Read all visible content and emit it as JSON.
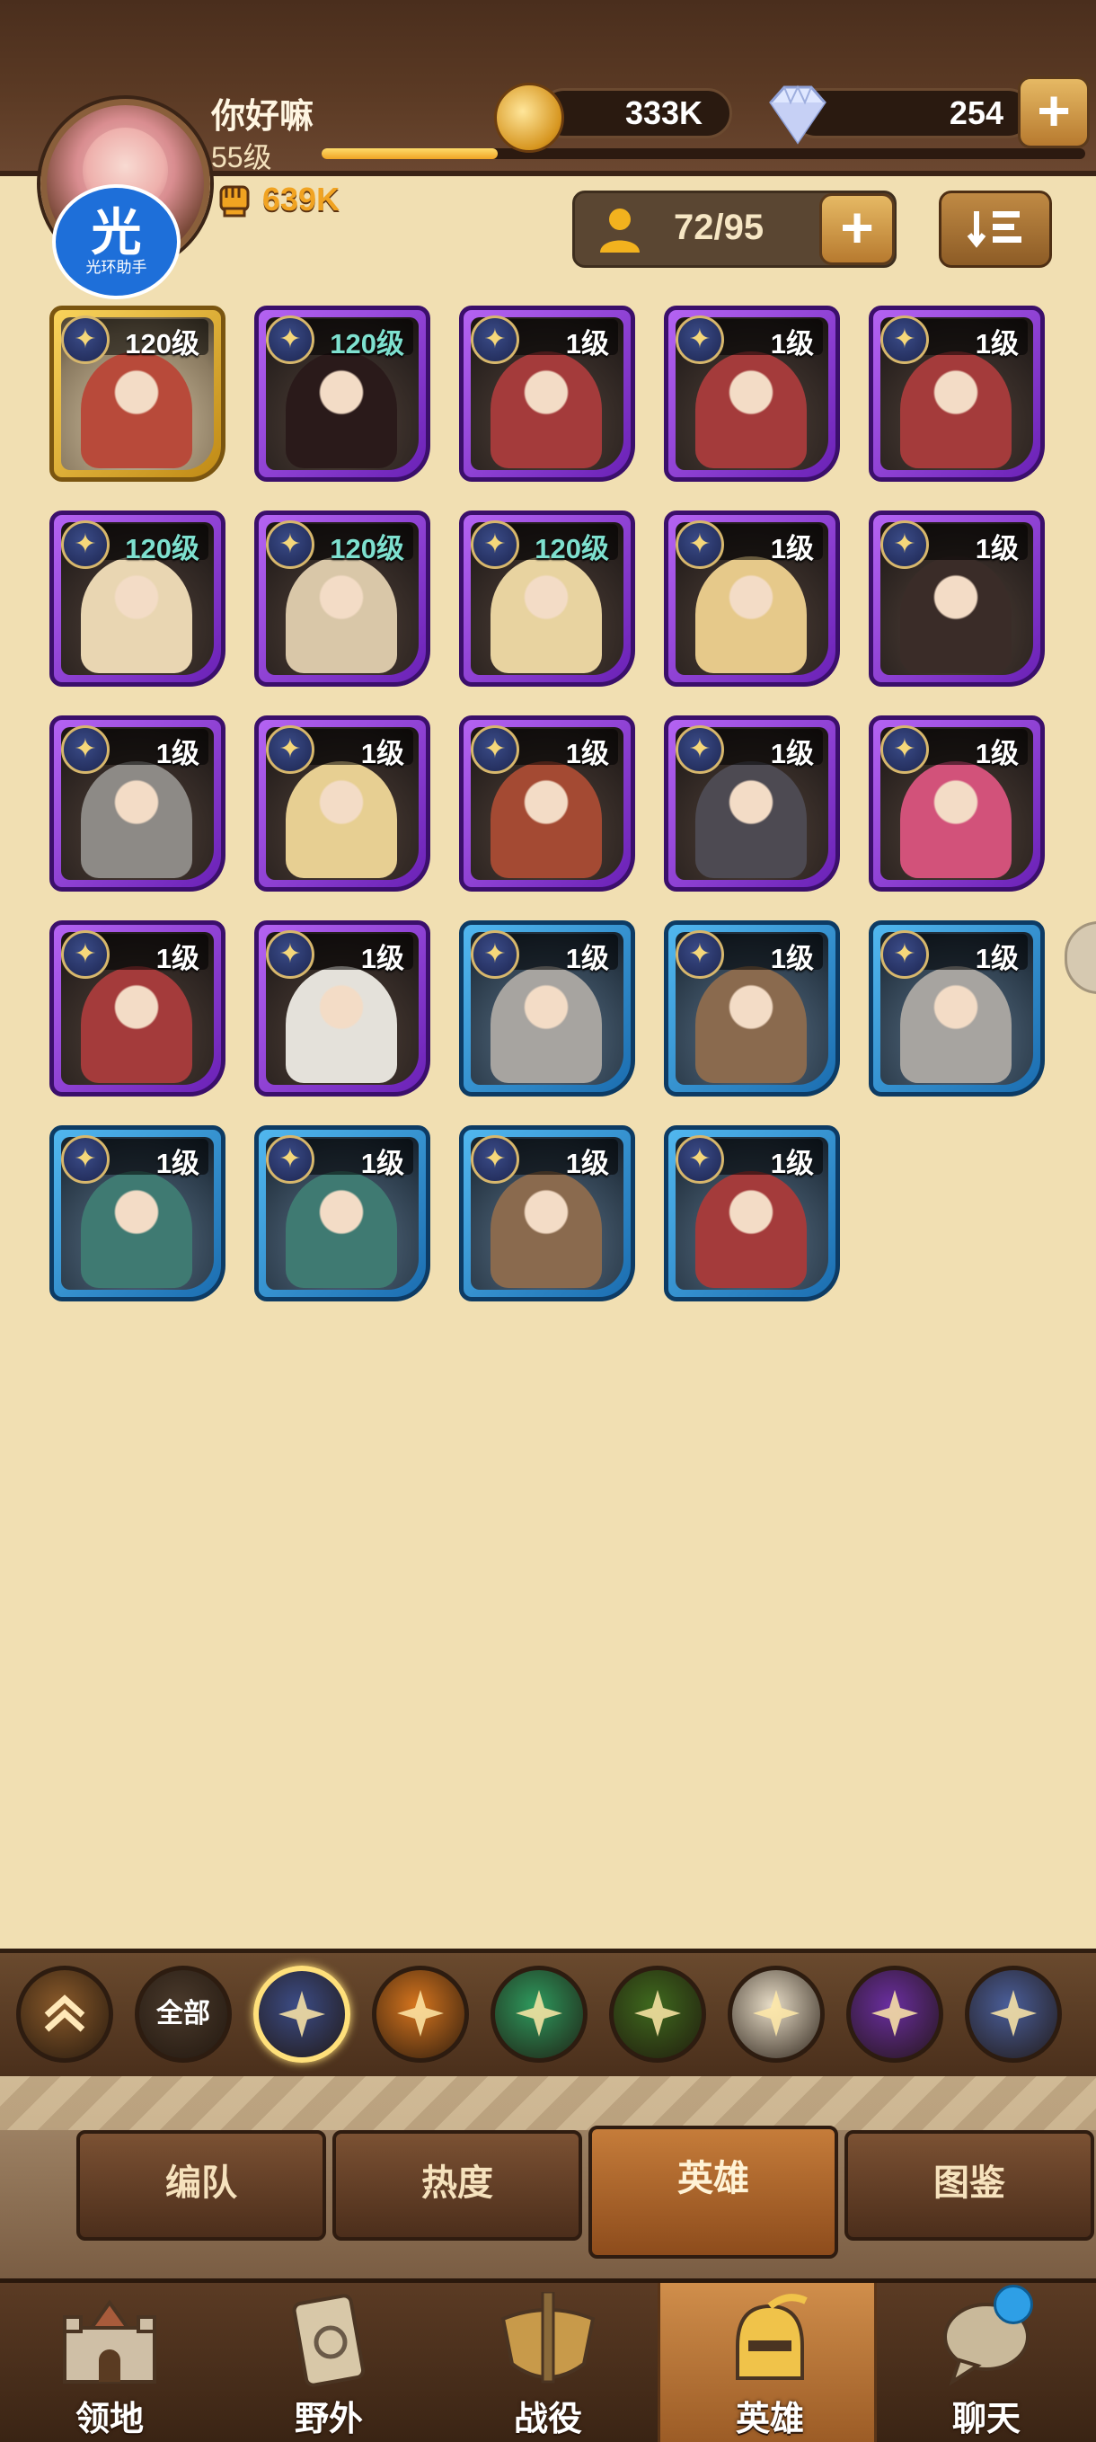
{
  "player": {
    "name": "你好嘛",
    "level": "55级",
    "power": "639K",
    "xp_fraction": 0.23
  },
  "resources": {
    "gold": "333K",
    "diamonds": "254"
  },
  "assistant_badge": {
    "glyph": "光",
    "label": "光环助手"
  },
  "hero_count": "72/95",
  "sort_icon": "sort-list-icon",
  "heroes": [
    {
      "level": "120级",
      "frame": "gold",
      "portrait": "#b84a3a"
    },
    {
      "level": "120级",
      "frame": "purple",
      "portrait": "#2a1a1a"
    },
    {
      "level": "1级",
      "frame": "purple",
      "portrait": "#a43b3b"
    },
    {
      "level": "1级",
      "frame": "purple",
      "portrait": "#a43b3b"
    },
    {
      "level": "1级",
      "frame": "purple",
      "portrait": "#a43b3b"
    },
    {
      "level": "120级",
      "frame": "purple",
      "portrait": "#e9d6b2"
    },
    {
      "level": "120级",
      "frame": "purple",
      "portrait": "#d9c7a8"
    },
    {
      "level": "120级",
      "frame": "purple",
      "portrait": "#e8d3a0"
    },
    {
      "level": "1级",
      "frame": "purple",
      "portrait": "#e6c98a"
    },
    {
      "level": "1级",
      "frame": "purple",
      "portrait": "#3a2c28"
    },
    {
      "level": "1级",
      "frame": "purple",
      "portrait": "#8d8a86"
    },
    {
      "level": "1级",
      "frame": "purple",
      "portrait": "#e7cf92"
    },
    {
      "level": "1级",
      "frame": "purple",
      "portrait": "#a44a33"
    },
    {
      "level": "1级",
      "frame": "purple",
      "portrait": "#4d4a52"
    },
    {
      "level": "1级",
      "frame": "purple",
      "portrait": "#d2527a"
    },
    {
      "level": "1级",
      "frame": "purple",
      "portrait": "#a43b3b"
    },
    {
      "level": "1级",
      "frame": "purple",
      "portrait": "#e4e1da"
    },
    {
      "level": "1级",
      "frame": "blue",
      "portrait": "#a7a4a0"
    },
    {
      "level": "1级",
      "frame": "blue",
      "portrait": "#8a6a4e"
    },
    {
      "level": "1级",
      "frame": "blue",
      "portrait": "#a7a4a0"
    },
    {
      "level": "1级",
      "frame": "blue",
      "portrait": "#3f7a72"
    },
    {
      "level": "1级",
      "frame": "blue",
      "portrait": "#3f7a72"
    },
    {
      "level": "1级",
      "frame": "blue",
      "portrait": "#8a6a4e"
    },
    {
      "level": "1级",
      "frame": "blue",
      "portrait": "#a43b3b"
    }
  ],
  "filters": [
    {
      "icon": "collapse-chevron-icon",
      "label": "",
      "color": "#8a5a2a"
    },
    {
      "icon": "all-factions-icon",
      "label": "全部",
      "color": "#4a3a2c"
    },
    {
      "icon": "lightbearer-star-icon",
      "label": "",
      "color": "#3c4c86",
      "active": true
    },
    {
      "icon": "mauler-icon",
      "label": "",
      "color": "#d6751e"
    },
    {
      "icon": "wilder-leaf-icon",
      "label": "",
      "color": "#2e9a5e"
    },
    {
      "icon": "graveborn-eye-icon",
      "label": "",
      "color": "#3f6a1e"
    },
    {
      "icon": "celestial-icon",
      "label": "",
      "color": "#e8ddc7"
    },
    {
      "icon": "hypogean-icon",
      "label": "",
      "color": "#6a2ea0"
    },
    {
      "icon": "dimensional-icon",
      "label": "",
      "color": "#4a5e9a"
    }
  ],
  "tabs": [
    {
      "label": "编队"
    },
    {
      "label": "热度"
    },
    {
      "label": "英雄",
      "active": true
    },
    {
      "label": "图鉴"
    }
  ],
  "nav": [
    {
      "label": "领地",
      "icon": "castle-icon"
    },
    {
      "label": "野外",
      "icon": "scroll-map-icon"
    },
    {
      "label": "战役",
      "icon": "battle-crest-icon"
    },
    {
      "label": "英雄",
      "icon": "hero-helmet-icon",
      "active": true
    },
    {
      "label": "聊天",
      "icon": "chat-bubble-icon"
    }
  ]
}
